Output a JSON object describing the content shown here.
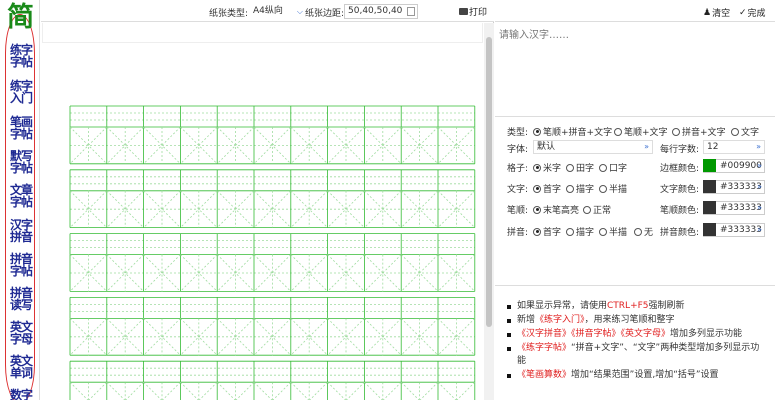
{
  "sidebar": {
    "logo": "简",
    "items": [
      {
        "label": "练字字帖"
      },
      {
        "label": "练字入门"
      },
      {
        "label": "笔画字帖"
      },
      {
        "label": "默写字帖"
      },
      {
        "label": "文章字帖"
      },
      {
        "label": "汉字拼音"
      },
      {
        "label": "拼音字帖"
      },
      {
        "label": "拼音读写"
      },
      {
        "label": "英文字母"
      },
      {
        "label": "英文单词"
      },
      {
        "label": "数字"
      }
    ]
  },
  "toolbar": {
    "paper_type_label": "纸张类型:",
    "paper_type_value": "A4纵向",
    "margin_label": "纸张边距:",
    "margin_value": "50,40,50,40",
    "print_label": "打印"
  },
  "right_toolbar": {
    "clear_label": "清空",
    "done_label": "完成"
  },
  "text_input": {
    "placeholder": "请输入汉字……",
    "value": ""
  },
  "options": {
    "type": {
      "label": "类型:",
      "choices": [
        {
          "label": "笔顺+拼音+文字",
          "selected": true
        },
        {
          "label": "笔顺+文字",
          "selected": false
        },
        {
          "label": "拼音+文字",
          "selected": false
        },
        {
          "label": "文字",
          "selected": false
        }
      ]
    },
    "font": {
      "label": "字体:",
      "value": "默认"
    },
    "chars_per_row": {
      "label": "每行字数:",
      "value": "12"
    },
    "grid": {
      "label": "格子:",
      "choices": [
        {
          "label": "米字",
          "selected": true
        },
        {
          "label": "田字",
          "selected": false
        },
        {
          "label": "口字",
          "selected": false
        }
      ],
      "color_label": "边框颜色:",
      "color_value": "#009900",
      "color": "#009900"
    },
    "text": {
      "label": "文字:",
      "choices": [
        {
          "label": "首字",
          "selected": true
        },
        {
          "label": "描字",
          "selected": false
        },
        {
          "label": "半描",
          "selected": false
        }
      ],
      "color_label": "文字颜色:",
      "color_value": "#333333",
      "color": "#333333"
    },
    "stroke": {
      "label": "笔顺:",
      "choices": [
        {
          "label": "末笔高亮",
          "selected": true
        },
        {
          "label": "正常",
          "selected": false
        }
      ],
      "color_label": "笔顺颜色:",
      "color_value": "#333333",
      "color": "#333333"
    },
    "pinyin": {
      "label": "拼音:",
      "choices": [
        {
          "label": "首字",
          "selected": true
        },
        {
          "label": "描字",
          "selected": false
        },
        {
          "label": "半描",
          "selected": false
        },
        {
          "label": "无",
          "selected": false
        }
      ],
      "color_label": "拼音颜色:",
      "color_value": "#333333",
      "color": "#333333"
    }
  },
  "notes": {
    "n1a": "如果显示异常，请使用",
    "n1b": "CTRL+F5",
    "n1c": "强制刷新",
    "n2a": "新增",
    "n2b": "《练字入门》",
    "n2c": "，用来练习笔顺和整字",
    "n3a": "《汉字拼音》《拼音字帖》《英文字母》",
    "n3b": "增加多列显示功能",
    "n4a": "《练字字帖》",
    "n4b": "“拼音+文字”、“文字”两种类型增加多列显示功能",
    "n5a": "《笔画算数》",
    "n5b": "增加“结果范围”设置,增加“括号”设置"
  },
  "colors": {
    "grid_green": "#33bb33",
    "grid_light": "#9fdc9f",
    "accent_red": "#e02020",
    "nav_blue": "#1f2a93"
  }
}
